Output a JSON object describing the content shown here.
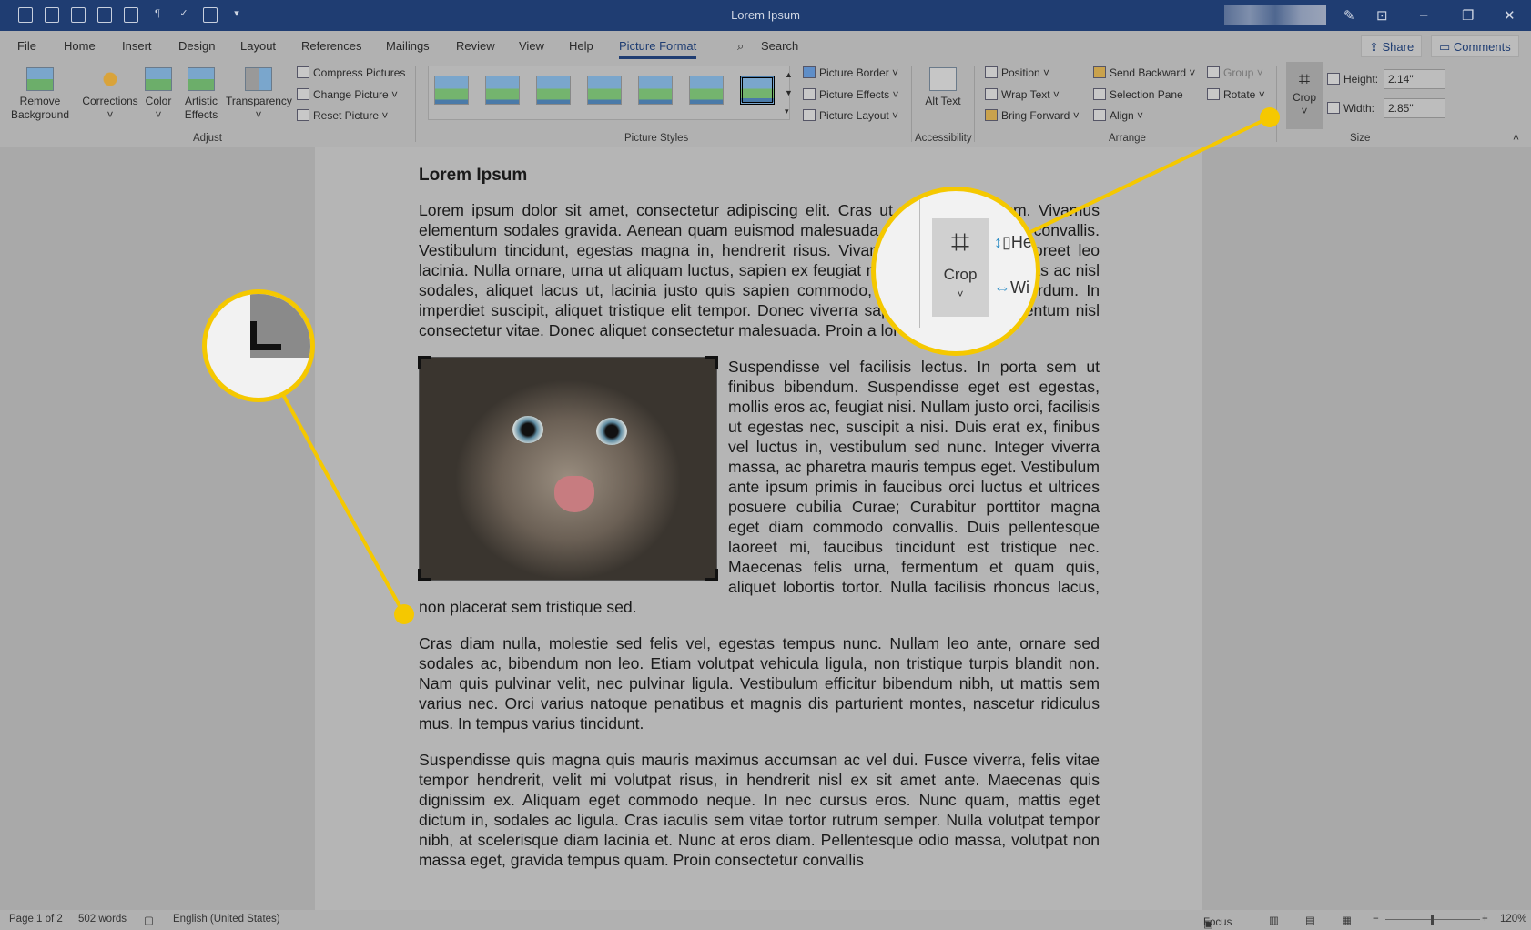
{
  "title": "Lorem Ipsum",
  "tabs": [
    "File",
    "Home",
    "Insert",
    "Design",
    "Layout",
    "References",
    "Mailings",
    "Review",
    "View",
    "Help",
    "Picture Format"
  ],
  "search": "Search",
  "share": "Share",
  "comments": "Comments",
  "adjust": {
    "remove_bg": "Remove Background",
    "corrections": "Corrections",
    "color": "Color",
    "artistic": "Artistic Effects",
    "transparency": "Transparency",
    "compress": "Compress Pictures",
    "change": "Change Picture",
    "reset": "Reset Picture",
    "label": "Adjust"
  },
  "styles": {
    "label": "Picture Styles",
    "border": "Picture Border",
    "effects": "Picture Effects",
    "layout": "Picture Layout"
  },
  "accessibility": {
    "alt": "Alt Text",
    "label": "Accessibility"
  },
  "arrange": {
    "position": "Position",
    "wrap": "Wrap Text",
    "forward": "Bring Forward",
    "backward": "Send Backward",
    "pane": "Selection Pane",
    "align": "Align",
    "group": "Group",
    "rotate": "Rotate",
    "label": "Arrange"
  },
  "size": {
    "crop": "Crop",
    "height_label": "Height:",
    "height": "2.14\"",
    "width_label": "Width:",
    "width": "2.85\"",
    "label": "Size"
  },
  "doc": {
    "heading": "Lorem Ipsum",
    "p1": "Lorem ipsum dolor sit amet, consectetur adipiscing elit. Cras ut viverra bibendum. Vivamus elementum sodales gravida. Aenean quam euismod malesuada. Proin luctus feugiat convallis. Vestibulum tincidunt, egestas magna in, hendrerit risus. Vivamus cursus enim a laoreet leo lacinia. Nulla ornare, urna ut aliquam luctus, sapien ex feugiat neque dui at neque. Cras ac nisl sodales, aliquet lacus ut, lacinia justo quis sapien commodo, id tempus neque interdum. In imperdiet suscipit, aliquet tristique elit tempor. Donec viverra sapien augue, et fermentum nisl consectetur vitae. Donec aliquet consectetur malesuada. Proin a lorem justo.",
    "p2": "Suspendisse vel facilisis lectus. In porta sem ut finibus bibendum. Suspendisse eget est egestas, mollis eros ac, feugiat nisi. Nullam justo orci, facilisis ut egestas nec, suscipit a nisi. Duis erat ex, finibus vel luctus in, vestibulum sed nunc. Integer viverra massa, ac pharetra mauris tempus eget. Vestibulum ante ipsum primis in faucibus orci luctus et ultrices posuere cubilia Curae; Curabitur porttitor magna eget diam commodo convallis. Duis pellentesque laoreet mi, faucibus tincidunt est tristique nec. Maecenas felis urna, fermentum et quam quis, aliquet lobortis tortor. Nulla facilisis rhoncus lacus, non placerat sem tristique sed.",
    "p3": "Cras diam nulla, molestie sed felis vel, egestas tempus nunc. Nullam leo ante, ornare sed sodales ac, bibendum non leo. Etiam volutpat vehicula ligula, non tristique turpis blandit non. Nam quis pulvinar velit, nec pulvinar ligula. Vestibulum efficitur bibendum nibh, ut mattis sem varius nec. Orci varius natoque penatibus et magnis dis parturient montes, nascetur ridiculus mus. In tempus varius tincidunt.",
    "p4": "Suspendisse quis magna quis mauris maximus accumsan ac vel dui. Fusce viverra, felis vitae tempor hendrerit, velit mi volutpat risus, in hendrerit nisl ex sit amet ante. Maecenas quis dignissim ex. Aliquam eget commodo neque. In nec cursus eros. Nunc quam, mattis eget dictum in, sodales ac ligula. Cras iaculis sem vitae tortor rutrum semper. Nulla volutpat tempor nibh, at scelerisque diam lacinia et. Nunc at eros diam. Pellentesque odio massa, volutpat non massa eget, gravida tempus quam. Proin consectetur convallis"
  },
  "magnifier": {
    "crop": "Crop",
    "he": "He",
    "wi": "Wi"
  },
  "status": {
    "page": "Page 1 of 2",
    "words": "502 words",
    "language": "English (United States)",
    "focus": "Focus",
    "zoom": "120%"
  },
  "colors": {
    "titlebar": "#1f3d72",
    "highlight": "#f5c800"
  }
}
